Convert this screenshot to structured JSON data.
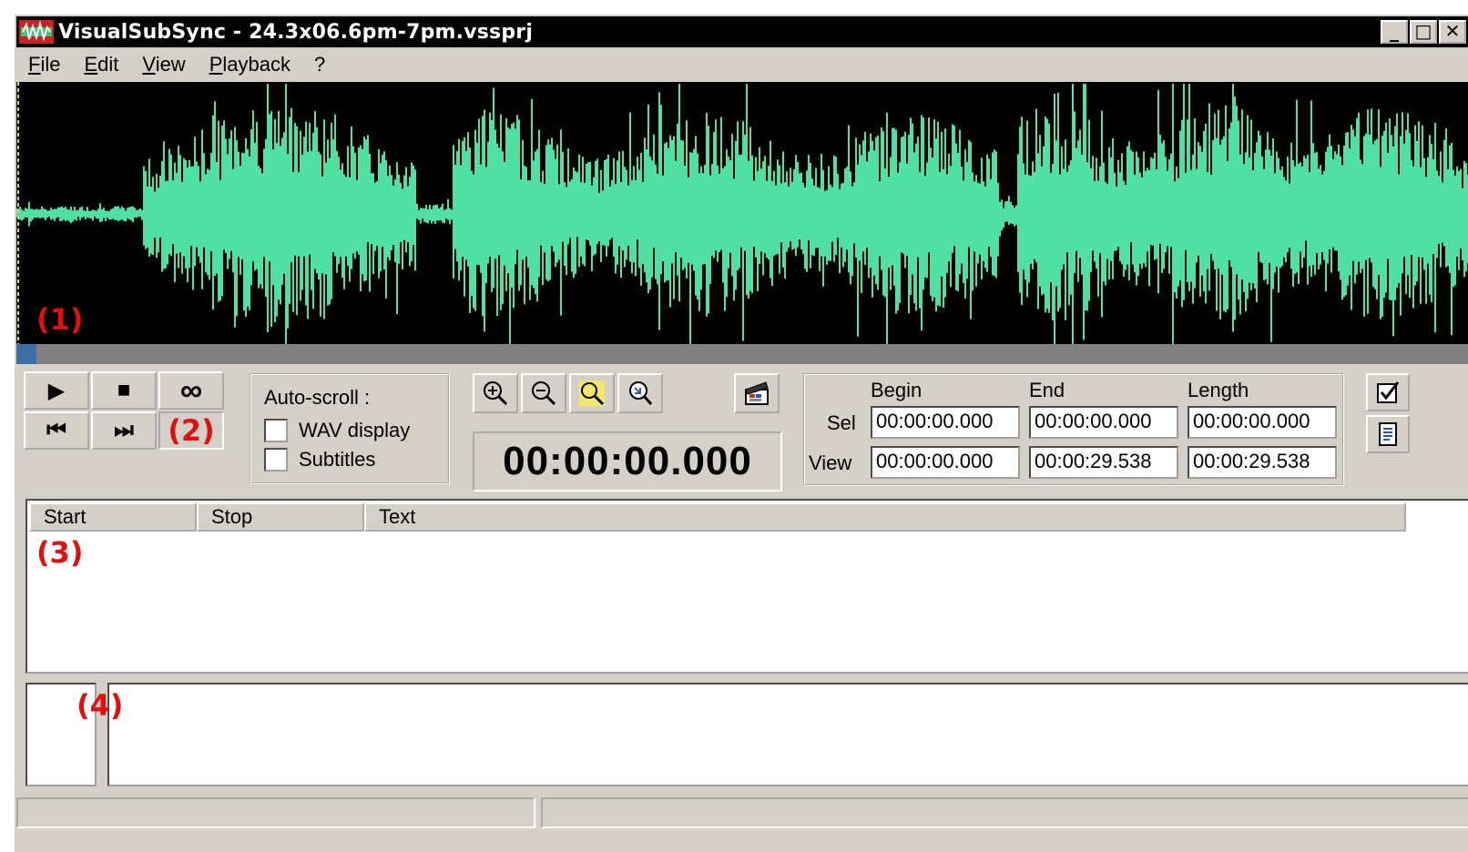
{
  "window": {
    "title": "VisualSubSync - 24.3x06.6pm-7pm.vssprj",
    "controls": {
      "minimize": "_",
      "maximize": "□",
      "close": "✕"
    }
  },
  "menu": {
    "items": [
      {
        "label": "File",
        "mnemonic": "F",
        "rest": "ile"
      },
      {
        "label": "Edit",
        "mnemonic": "E",
        "rest": "dit"
      },
      {
        "label": "View",
        "mnemonic": "V",
        "rest": "iew"
      },
      {
        "label": "Playback",
        "mnemonic": "P",
        "rest": "layback"
      },
      {
        "label": "?",
        "mnemonic": "",
        "rest": "?"
      }
    ]
  },
  "markers": {
    "m1": "(1)",
    "m2": "(2)",
    "m3": "(3)",
    "m4": "(4)"
  },
  "colors": {
    "waveform": "#4fe0a3",
    "marker": "#e01010",
    "background": "#d4d0c8",
    "scroll_thumb": "#3a6ea5"
  },
  "playback": {
    "play_icon": "play-icon",
    "stop_icon": "stop-icon",
    "loop_icon": "loop-icon",
    "prev_icon": "skip-back-icon",
    "next_icon": "skip-forward-icon",
    "play_glyph": "▶",
    "stop_glyph": "■",
    "loop_glyph": "∞",
    "prev_glyph": "⏮",
    "next_glyph": "⏭"
  },
  "autoscroll": {
    "label": "Auto-scroll :",
    "wav_display": "WAV display",
    "subtitles": "Subtitles",
    "wav_checked": false,
    "subtitles_checked": false
  },
  "zoom_tools": [
    "zoom-in-icon",
    "zoom-out-icon",
    "zoom-selection-icon",
    "zoom-all-icon"
  ],
  "current_time": "00:00:00.000",
  "timing": {
    "headers": {
      "begin": "Begin",
      "end": "End",
      "length": "Length"
    },
    "sel": {
      "label": "Sel",
      "begin": "00:00:00.000",
      "end": "00:00:00.000",
      "length": "00:00:00.000"
    },
    "view": {
      "label": "View",
      "begin": "00:00:00.000",
      "end": "00:00:29.538",
      "length": "00:00:29.538"
    }
  },
  "subtitle_list": {
    "columns": [
      "Start",
      "Stop",
      "Text"
    ],
    "rows": []
  },
  "statusbar": {
    "left": "",
    "right": ""
  }
}
